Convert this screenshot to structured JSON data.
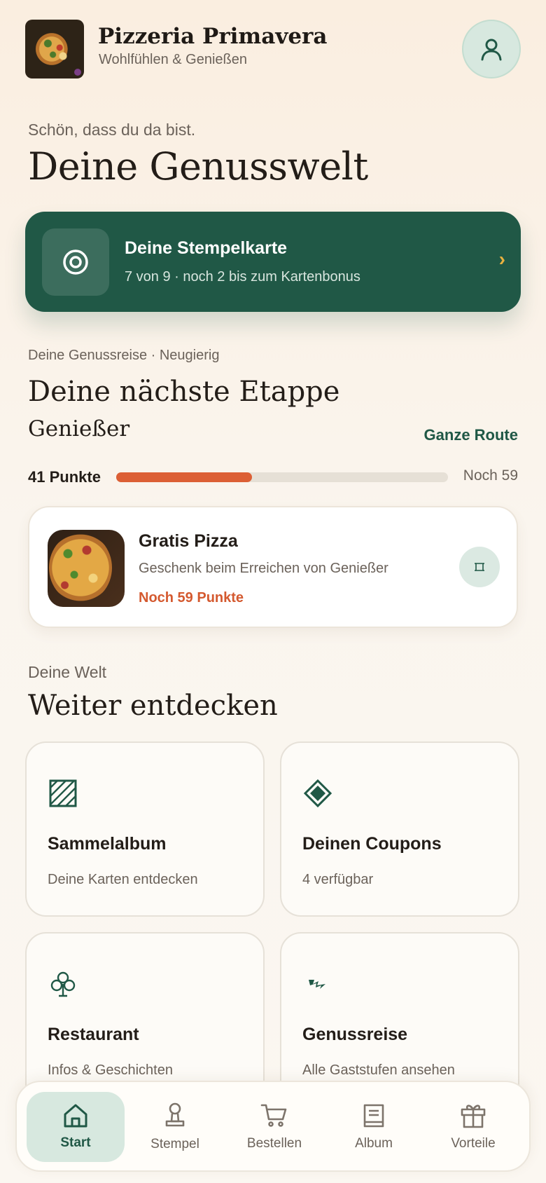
{
  "header": {
    "brand_name": "Pizzeria Primavera",
    "tagline": "Wohlfühlen & Genießen",
    "profile_icon": "user-icon"
  },
  "greeting": "Schön, dass du da bist.",
  "main_title": "Deine Genusswelt",
  "stamp_card": {
    "title": "Deine Stempelkarte",
    "subtitle": "7 von 9 · noch 2 bis zum Kartenbonus",
    "chevron": "›",
    "icon": "target-icon"
  },
  "journey": {
    "label": "Deine Genussreise · Neugierig",
    "title": "Deine nächste Etappe",
    "level": "Genießer",
    "route_link": "Ganze Route",
    "points_label": "41 Punkte",
    "progress_fraction": 0.41,
    "remaining_label": "Noch 59"
  },
  "reward": {
    "title": "Gratis Pizza",
    "description": "Geschenk beim Erreichen von Genießer",
    "points_needed": "Noch 59 Punkte",
    "action_icon": "frame-icon"
  },
  "discover": {
    "label": "Deine Welt",
    "title": "Weiter entdecken",
    "tiles": [
      {
        "title": "Sammelalbum",
        "subtitle": "Deine Karten entdecken",
        "icon": "hatched-square-icon"
      },
      {
        "title": "Deinen Coupons",
        "subtitle": "4 verfügbar",
        "icon": "diamond-icon"
      },
      {
        "title": "Restaurant",
        "subtitle": "Infos & Geschichten",
        "icon": "club-icon"
      },
      {
        "title": "Genussreise",
        "subtitle": "Alle Gaststufen ansehen",
        "icon": "lightning-icon"
      }
    ]
  },
  "nav": {
    "items": [
      {
        "label": "Start",
        "icon": "home-icon",
        "active": true
      },
      {
        "label": "Stempel",
        "icon": "stamp-icon",
        "active": false
      },
      {
        "label": "Bestellen",
        "icon": "cart-icon",
        "active": false
      },
      {
        "label": "Album",
        "icon": "book-icon",
        "active": false
      },
      {
        "label": "Vorteile",
        "icon": "gift-icon",
        "active": false
      }
    ]
  },
  "colors": {
    "primary_green": "#205846",
    "accent_orange": "#dc5f35",
    "chevron_gold": "#e9b13f",
    "background": "#faf3ea"
  }
}
